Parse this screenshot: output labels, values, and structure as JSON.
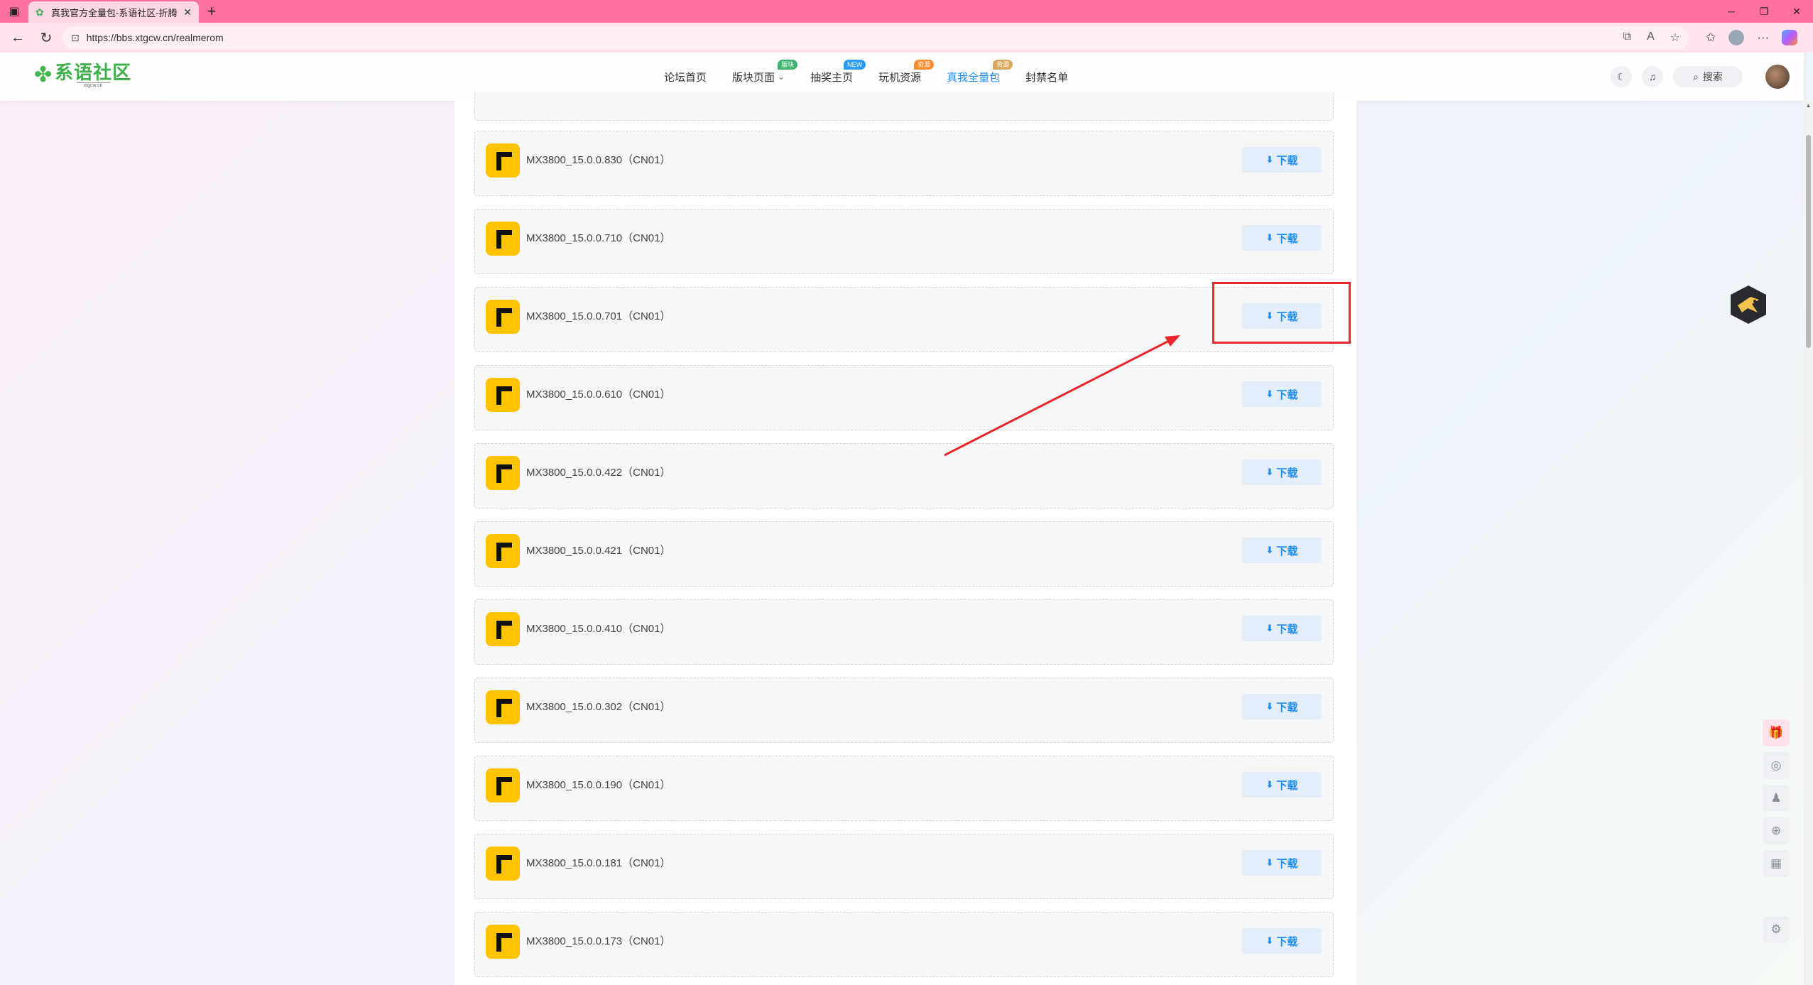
{
  "browser": {
    "tab_title": "真我官方全量包-系语社区-折腾",
    "url": "https://bbs.xtgcw.cn/realmerom",
    "new_tab_glyph": "+",
    "tab_close_glyph": "✕"
  },
  "site": {
    "logo_name": "系语社区",
    "logo_domain": "xtgcw.cn",
    "nav": [
      {
        "label": "论坛首页",
        "badge": ""
      },
      {
        "label": "版块页面",
        "badge": "版块",
        "badge_color": "#3db36b"
      },
      {
        "label": "抽奖主页",
        "badge": "NEW",
        "badge_color": "#2b9af3"
      },
      {
        "label": "玩机资源",
        "badge": "资源",
        "badge_color": "#ff8a2b"
      },
      {
        "label": "真我全量包",
        "badge": "资源",
        "badge_color": "#d9a55a"
      },
      {
        "label": "封禁名单",
        "badge": ""
      }
    ],
    "search_label": "搜索"
  },
  "roms": {
    "download_label": "下载",
    "items": [
      {
        "name": "MX3800_15.0.0.830（CN01）"
      },
      {
        "name": "MX3800_15.0.0.710（CN01）"
      },
      {
        "name": "MX3800_15.0.0.701（CN01）"
      },
      {
        "name": "MX3800_15.0.0.610（CN01）"
      },
      {
        "name": "MX3800_15.0.0.422（CN01）"
      },
      {
        "name": "MX3800_15.0.0.421（CN01）"
      },
      {
        "name": "MX3800_15.0.0.410（CN01）"
      },
      {
        "name": "MX3800_15.0.0.302（CN01）"
      },
      {
        "name": "MX3800_15.0.0.190（CN01）"
      },
      {
        "name": "MX3800_15.0.0.181（CN01）"
      },
      {
        "name": "MX3800_15.0.0.173（CN01）"
      }
    ]
  },
  "colors": {
    "accent": "#1e8ef0",
    "annotation": "#e8262b",
    "rom_icon": "#ffc400",
    "tabbar": "#ff6fa0"
  },
  "icons": [
    "sidebar-toggle-icon",
    "favicon-icon",
    "back-icon",
    "refresh-icon",
    "lock-icon",
    "moon-icon",
    "bell-icon",
    "search-icon",
    "download-icon",
    "gift-icon",
    "wechat-icon",
    "qq-icon",
    "plus-circle-icon",
    "qrcode-icon",
    "gear-icon"
  ]
}
